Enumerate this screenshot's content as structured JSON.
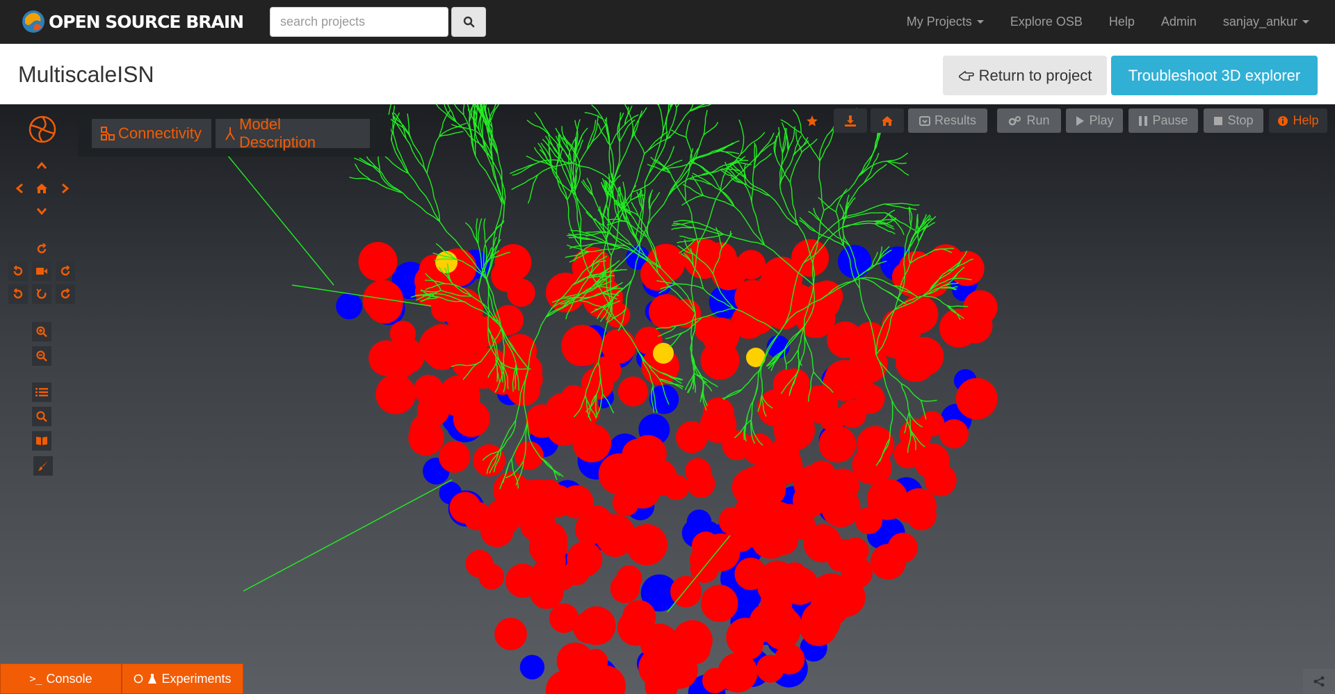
{
  "navbar": {
    "brand": "OPEN SOURCE BRAIN",
    "search_placeholder": "search projects",
    "links": [
      {
        "label": "My Projects"
      },
      {
        "label": "Explore OSB"
      },
      {
        "label": "Help"
      },
      {
        "label": "Admin"
      },
      {
        "label": "sanjay_ankur"
      }
    ]
  },
  "header": {
    "title": "MultiscaleISN",
    "return_label": "Return to project",
    "troubleshoot_label": "Troubleshoot 3D explorer"
  },
  "viewer": {
    "tabs": {
      "connectivity": "Connectivity",
      "model_description": "Model Description"
    },
    "toolbar": {
      "results": "Results",
      "run": "Run",
      "play": "Play",
      "pause": "Pause",
      "stop": "Stop",
      "help": "Help"
    },
    "bottom": {
      "console": "Console",
      "experiments": "Experiments"
    }
  },
  "colors": {
    "accent": "#f25c05",
    "excitatory": "#ff0000",
    "inhibitory": "#0000ff",
    "highlight": "#ffd000",
    "dendrite": "#22ee22",
    "troubleshoot": "#31b0d5"
  }
}
